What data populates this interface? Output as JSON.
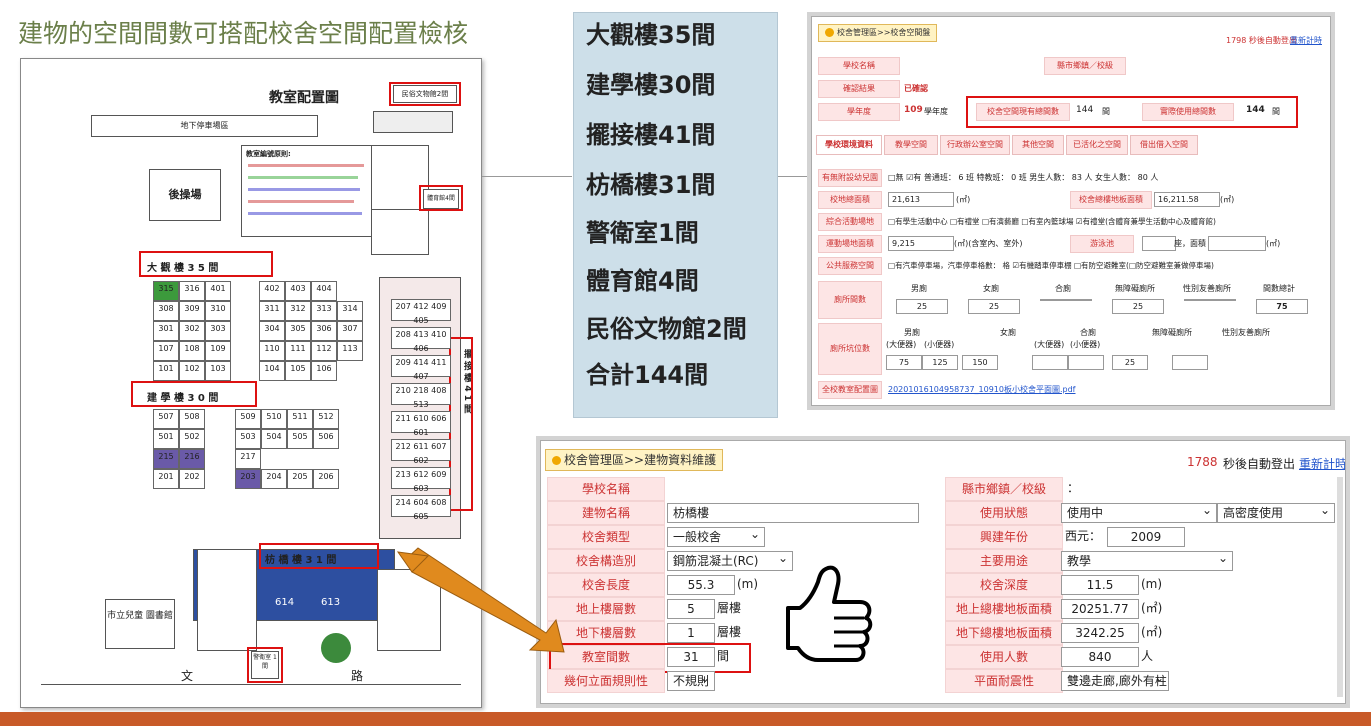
{
  "slide": {
    "title": "建物的空間間數可搭配校舍空間配置檢核"
  },
  "floorplan": {
    "title": "教室配置圖",
    "museum_label": "民俗文物館2間",
    "parking": "地下停車場區",
    "playground": "後操場",
    "daguan": "大 觀 樓  3 5  間",
    "jianxue": "建 學 樓  3 0  間",
    "fangqiao": "枋 橋 樓  3 1  間",
    "baijie": "擺 接 樓  4 1  間",
    "guard": "警衛室 1間",
    "gym": "體育館4間",
    "notes_title": "教室編號原則:",
    "road1": "文",
    "road2": "路",
    "library": "市立兒童 圖書館",
    "daguan_rooms_r1": [
      "315",
      "316",
      "401",
      "402",
      "403",
      "404"
    ],
    "daguan_rooms_r2": [
      "308",
      "309",
      "310",
      "311",
      "312",
      "313",
      "314"
    ],
    "daguan_rooms_r3": [
      "301",
      "302",
      "303",
      "304",
      "305",
      "306",
      "307"
    ],
    "daguan_rooms_r4": [
      "107",
      "108",
      "109",
      "110",
      "111",
      "112",
      "113"
    ],
    "daguan_rooms_r5": [
      "101",
      "102",
      "103",
      "104",
      "105",
      "106"
    ],
    "jianxue_rooms_r1": [
      "507",
      "508",
      "509",
      "510",
      "511",
      "512"
    ],
    "jianxue_rooms_r2": [
      "501",
      "502",
      "503",
      "504",
      "505",
      "506"
    ],
    "jianxue_rooms_r3": [
      "215",
      "216",
      "217"
    ],
    "jianxue_rooms_r4": [
      "201",
      "202",
      "203",
      "204",
      "205",
      "206"
    ],
    "baijie_rooms": [
      "207 412 409 405",
      "208 413 410 406",
      "209 414 411 407",
      "210 218 408 513",
      "211 610 606 601",
      "212 611 607 602",
      "213 612 609 603",
      "214 604 608 605"
    ],
    "fangqiao_room": "614",
    "fangqiao_room2": "613"
  },
  "summary": {
    "lines": [
      "大觀樓35間",
      "建學樓30間",
      "擺接樓41間",
      "枋橋樓31間",
      "警衛室1間",
      "體育館4間",
      "民俗文物館2間",
      "合計144間"
    ]
  },
  "upper_window": {
    "tab": "校舍管理區>>校舍空間盤",
    "timer": "1798 秒後自動登出",
    "refresh": "重新計時",
    "school_name_label": "學校名稱",
    "county_label": "縣市鄉鎮／校級",
    "confirm_label": "確認結果",
    "confirm_value": "已確認",
    "year_label": "學年度",
    "year_value": "109",
    "year_unit": "學年度",
    "existing_label": "校舍空間現有總間數",
    "existing_value": "144",
    "existing_unit": "間",
    "actual_label": "實際使用總間數",
    "actual_value": "144",
    "actual_unit": "間",
    "tabs": [
      "學校環境資料",
      "教學空間",
      "行政辦公室空間",
      "其他空間",
      "已活化之空間",
      "借出借入空間"
    ],
    "r1_label": "有無附設幼兒園",
    "r1_value": "□無 ☑有  普通班：  6  班  特教班：  0  班  男生人數：  83  人 女生人數：  80  人",
    "r2_label": "校地總面積",
    "r2_value": "21,613",
    "r2_unit": "(㎡)",
    "r2b_label": "校舍總樓地板面積",
    "r2b_value": "16,211.58",
    "r2b_unit": "(㎡)",
    "r3_label": "綜合活動場地",
    "r3_value": "□有學生活動中心  □有禮堂  □有演藝廳  □有室內籃球場  ☑有禮堂(含體育兼學生活動中心及體育館)",
    "r4_label": "運動場地面積",
    "r4_value": "9,215",
    "r4_unit": "(㎡)(含室內、室外)",
    "r4b_label": "游泳池",
    "r4b_unit": "座，面積",
    "r4c_unit": "(㎡)",
    "r5_label": "公共服務空間",
    "r5_value": "□有汽車停車場，汽車停車格數：       格 ☑有機踏車停車棚     □有防空避難室(□防空避難室兼做停車場)",
    "r6_label": "廁所間數",
    "r6_heads": [
      "男廁",
      "女廁",
      "合廁",
      "無障礙廁所",
      "性別友善廁所",
      "間數總計"
    ],
    "r6_values": [
      "25",
      "25",
      "",
      "25",
      "",
      "75"
    ],
    "r7_label": "廁所坑位數",
    "r7_heads": [
      "男廁",
      "女廁",
      "合廁",
      "無障礙廁所",
      "性別友善廁所"
    ],
    "r7_sub": [
      "(大便器)",
      "(小便器)",
      "(大便器)",
      "(小便器)"
    ],
    "r7_values": [
      "75",
      "125",
      "150",
      "",
      "",
      "25",
      ""
    ],
    "r8_label": "全校教室配置圖",
    "r8_value": "20201016104958737_10910板小校舍平面圖.pdf"
  },
  "lower_window": {
    "tab": "校舍管理區>>建物資料維護",
    "timer_num": "1788",
    "timer_text": "秒後自動登出",
    "refresh": "重新計時",
    "school_label": "學校名稱",
    "county_label": "縣市鄉鎮／校級",
    "county_value": "：",
    "name_label": "建物名稱",
    "name_value": "枋橋樓",
    "status_label": "使用狀態",
    "status_value": "使用中",
    "status_value2": "高密度使用",
    "type_label": "校舍類型",
    "type_value": "一般校舍",
    "year_label": "興建年份",
    "year_prefix": "西元：",
    "year_value": "2009",
    "struct_label": "校舍構造別",
    "struct_value": "鋼筋混凝土(RC)",
    "use_label": "主要用途",
    "use_value": "教學",
    "length_label": "校舍長度",
    "length_value": "55.3",
    "length_unit": "(m)",
    "depth_label": "校舍深度",
    "depth_value": "11.5",
    "depth_unit": "(m)",
    "above_label": "地上樓層數",
    "above_value": "5",
    "above_unit": "層樓",
    "above_area_label": "地上總樓地板面積",
    "above_area_value": "20251.77",
    "above_area_unit": "(㎡)",
    "below_label": "地下樓層數",
    "below_value": "1",
    "below_unit": "層樓",
    "below_area_label": "地下總樓地板面積",
    "below_area_value": "3242.25",
    "below_area_unit": "(㎡)",
    "rooms_label": "教室間數",
    "rooms_value": "31",
    "rooms_unit": "間",
    "users_label": "使用人數",
    "users_value": "840",
    "users_unit": "人",
    "geo_label": "幾何立面規則性",
    "geo_value": "不規則",
    "plan_label": "平面耐震性",
    "plan_value": "雙邊走廊,廊外有柱"
  },
  "colors": {
    "title": "#6b7f4a",
    "panel": "#cddfe9",
    "highlight": "#d11111",
    "arrow": "#e08a1e",
    "bar": "#c85a28"
  }
}
